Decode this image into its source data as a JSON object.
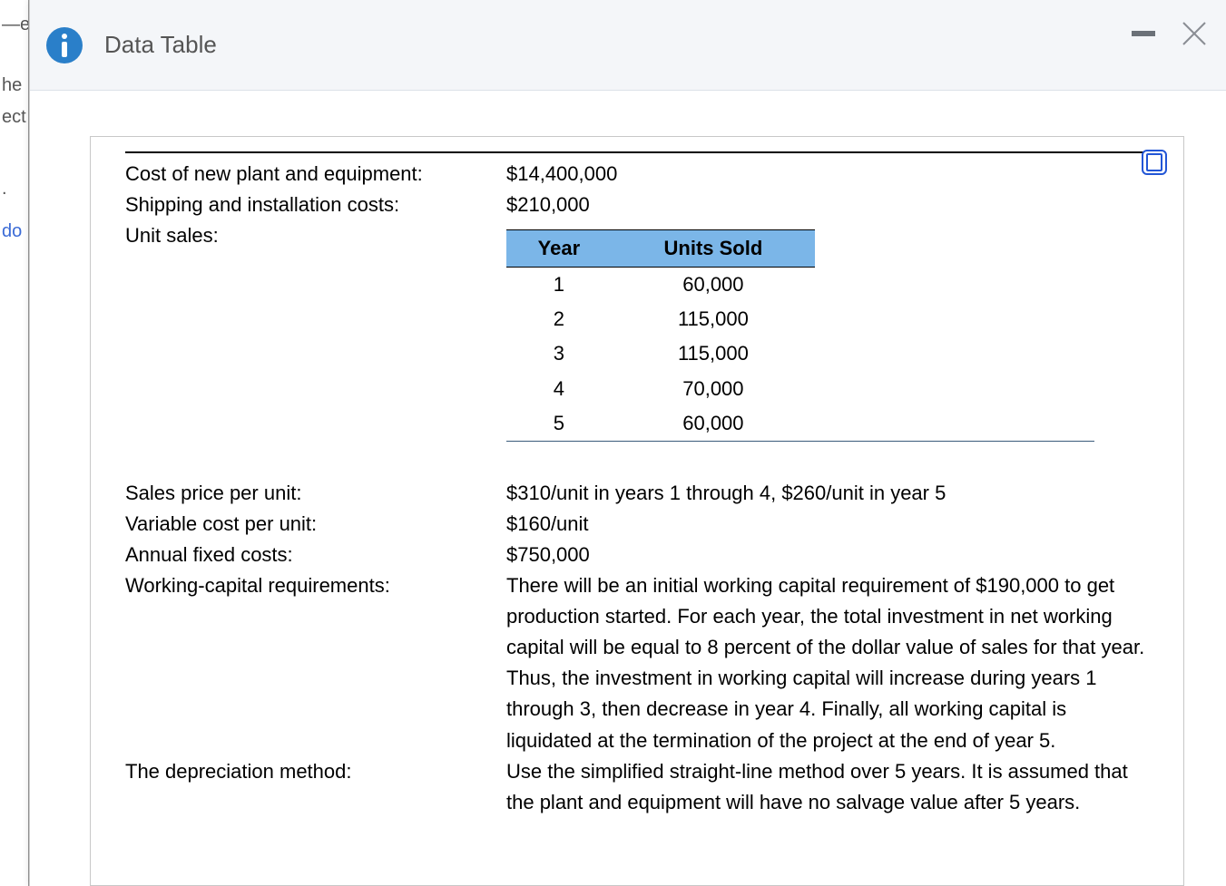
{
  "leftStrip": {
    "frag1": "—e",
    "frag2": "he",
    "frag3": "ect",
    "frag4": ".",
    "frag5": "do"
  },
  "header": {
    "title": "Data Table"
  },
  "doc": {
    "cost_label": "Cost of new plant and equipment:",
    "cost_value": "$14,400,000",
    "shipping_label": "Shipping and installation costs:",
    "shipping_value": "$210,000",
    "unitsales_label": "Unit sales:",
    "table": {
      "h1": "Year",
      "h2": "Units Sold",
      "r1c1": "1",
      "r1c2": "60,000",
      "r2c1": "2",
      "r2c2": "115,000",
      "r3c1": "3",
      "r3c2": "115,000",
      "r4c1": "4",
      "r4c2": "70,000",
      "r5c1": "5",
      "r5c2": "60,000"
    },
    "salesprice_label": "Sales price per unit:",
    "salesprice_value": "$310/unit in years 1 through 4, $260/unit in year 5",
    "varcost_label": "Variable cost per unit:",
    "varcost_value": "$160/unit",
    "fixed_label": "Annual fixed costs:",
    "fixed_value": "$750,000",
    "wc_label": "Working-capital requirements:",
    "wc_value": "There will be an initial working capital requirement of $190,000 to get production started.  For each year, the total investment in net working capital will be equal to 8 percent of the dollar value of sales for that year.  Thus, the investment in working capital will increase during years 1 through 3, then decrease in year 4.  Finally, all working capital is liquidated at the termination of the project at the end of year 5.",
    "dep_label": "The depreciation method:",
    "dep_value": "Use the simplified straight-line method over 5 years.  It is assumed that the plant and equipment will have no salvage value after 5 years."
  },
  "chart_data": {
    "type": "table",
    "title": "Unit sales by year",
    "columns": [
      "Year",
      "Units Sold"
    ],
    "rows": [
      [
        1,
        60000
      ],
      [
        2,
        115000
      ],
      [
        3,
        115000
      ],
      [
        4,
        70000
      ],
      [
        5,
        60000
      ]
    ]
  }
}
